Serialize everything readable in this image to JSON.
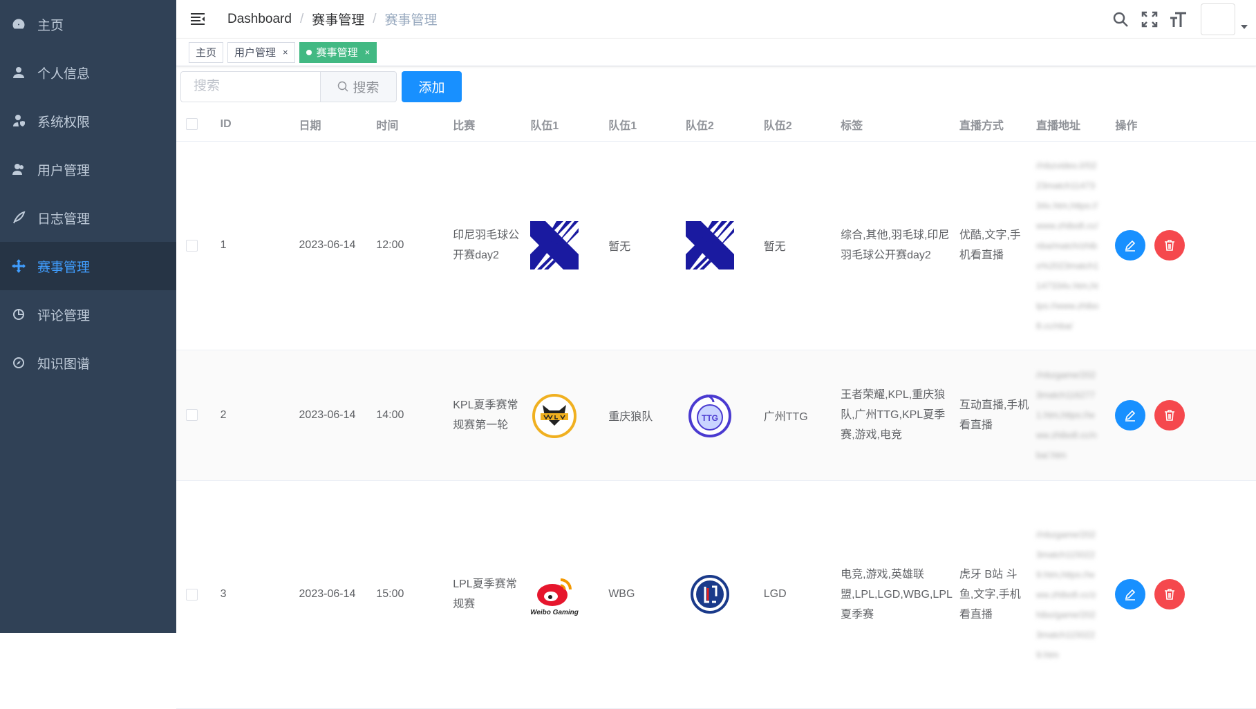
{
  "sidebar": {
    "items": [
      {
        "label": "主页",
        "icon": "dashboard-icon"
      },
      {
        "label": "个人信息",
        "icon": "user-icon"
      },
      {
        "label": "系统权限",
        "icon": "user-shield-icon"
      },
      {
        "label": "用户管理",
        "icon": "users-icon"
      },
      {
        "label": "日志管理",
        "icon": "feather-icon"
      },
      {
        "label": "赛事管理",
        "icon": "crosshair-icon"
      },
      {
        "label": "评论管理",
        "icon": "pie-chart-icon"
      },
      {
        "label": "知识图谱",
        "icon": "compass-icon"
      }
    ]
  },
  "breadcrumb": [
    "Dashboard",
    "赛事管理",
    "赛事管理"
  ],
  "tags": [
    {
      "label": "主页"
    },
    {
      "label": "用户管理",
      "close": "×"
    },
    {
      "label": "赛事管理",
      "close": "×"
    }
  ],
  "search": {
    "placeholder": "搜索",
    "button": "搜索"
  },
  "add_button": "添加",
  "table": {
    "headers": [
      "ID",
      "日期",
      "时间",
      "比赛",
      "队伍1",
      "队伍1",
      "队伍2",
      "队伍2",
      "标签",
      "直播方式",
      "直播地址",
      "操作"
    ],
    "rows": [
      {
        "id": "1",
        "date": "2023-06-14",
        "time": "12:00",
        "match": "印尼羽毛球公开赛day2",
        "team1_logo": "x-logo-icon",
        "team1": "暂无",
        "team2_logo": "x-logo-icon",
        "team2": "暂无",
        "tags": "综合,其他,羽毛球,印尼羽毛球公开赛day2",
        "live_mode": "优酷,文字,手机看直播",
        "live_url": "//nbzvideo.l//0223match1147334x.htm,https://www.zhibo8.cc/nba/match/zhibo%2023match1147334x.htm,https://www.zhibo8.cc/nba/"
      },
      {
        "id": "2",
        "date": "2023-06-14",
        "time": "14:00",
        "match": "KPL夏季赛常规赛第一轮",
        "team1_logo": "wolves-logo-icon",
        "team1": "重庆狼队",
        "team2_logo": "ttg-logo-icon",
        "team2": "广州TTG",
        "tags": "王者荣耀,KPL,重庆狼队,广州TTG,KPL夏季赛,游戏,电竞",
        "live_mode": "互动直播,手机看直播",
        "live_url": "//nbzgame/2023match1162771.htm,https://www.zhibo8.cc/nba/.htm"
      },
      {
        "id": "3",
        "date": "2023-06-14",
        "time": "15:00",
        "match": "LPL夏季赛常规赛",
        "team1_logo": "weibo-gaming-logo-icon",
        "team1": "WBG",
        "team2_logo": "lgd-logo-icon",
        "team2": "LGD",
        "tags": "电竞,游戏,英雄联盟,LPL,LGD,WBG,LPL夏季赛",
        "live_mode": "虎牙 B站 斗鱼,文字,手机看直播",
        "live_url": "//nbzgame/2023match1150229.htm,https://www.zhibo8.cc/zhibo/game/2023match1150229.htm"
      }
    ]
  },
  "colors": {
    "sidebar_bg": "#304156",
    "accent": "#409eff",
    "tag_active": "#42b983",
    "primary": "#1890ff",
    "danger": "#f5484d"
  }
}
